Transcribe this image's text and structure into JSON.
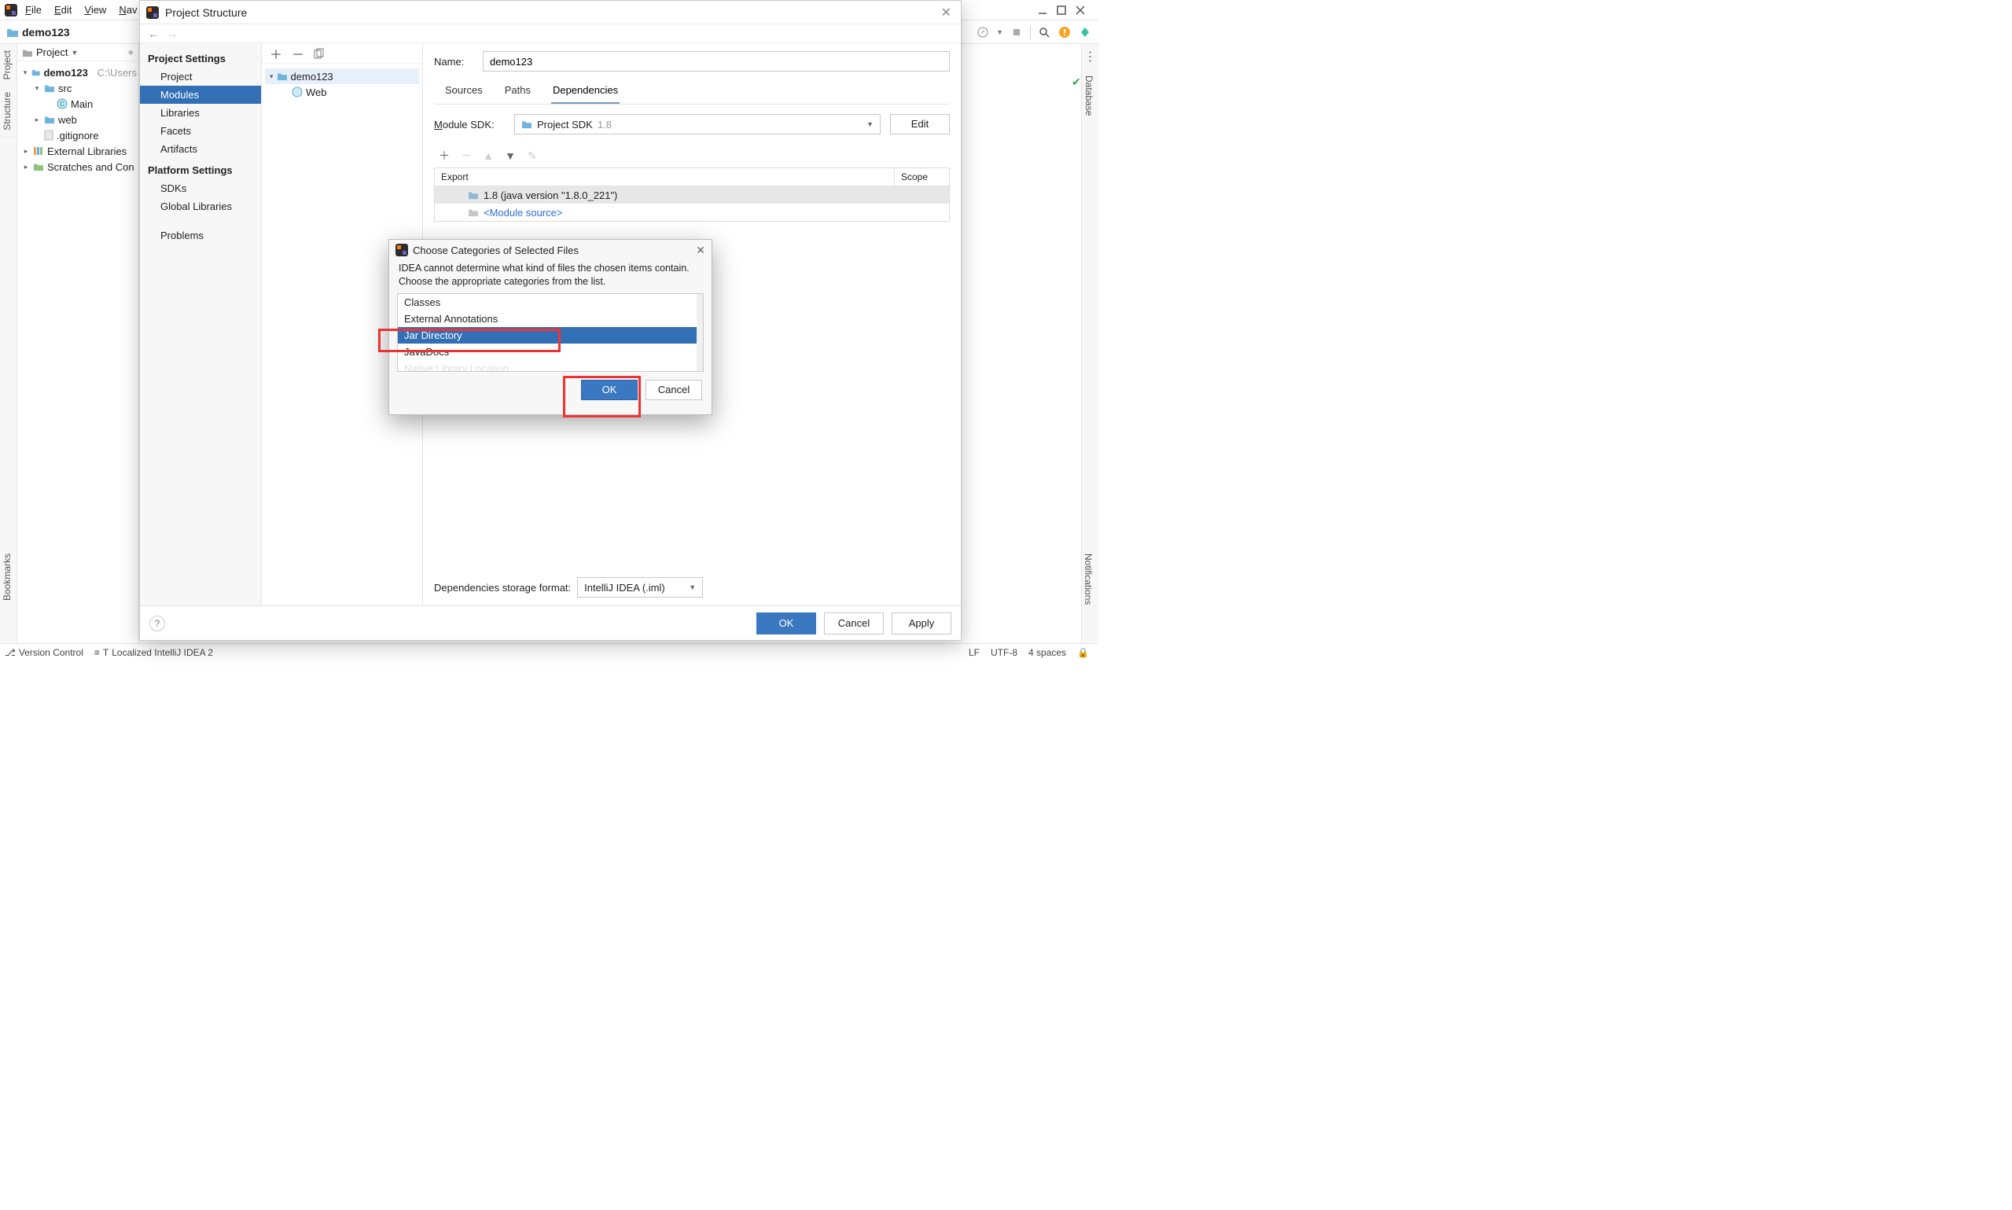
{
  "main_menu": [
    "File",
    "Edit",
    "View",
    "Nav"
  ],
  "breadcrumb": {
    "project": "demo123"
  },
  "left_rail_tabs": [
    "Project",
    "Structure"
  ],
  "right_rail_tabs": [
    "Database"
  ],
  "bottom_left_rail": "Bookmarks",
  "bottom_right_rail": "Notifications",
  "project_tool": {
    "title": "Project",
    "nodes": [
      {
        "label": "demo123",
        "suffix": "C:\\Users",
        "bold": true,
        "indent": 0,
        "arrow": "down",
        "icon": "folder"
      },
      {
        "label": "src",
        "indent": 1,
        "arrow": "down",
        "icon": "folder-blue"
      },
      {
        "label": "Main",
        "indent": 2,
        "icon": "class"
      },
      {
        "label": "web",
        "indent": 1,
        "arrow": "right",
        "icon": "folder-blue"
      },
      {
        "label": ".gitignore",
        "indent": 1,
        "icon": "file"
      },
      {
        "label": "External Libraries",
        "indent": 0,
        "arrow": "right",
        "icon": "lib"
      },
      {
        "label": "Scratches and Con",
        "indent": 0,
        "arrow": "right",
        "icon": "scratch"
      }
    ]
  },
  "bottom_tabs": [
    "Version Control",
    "T"
  ],
  "status_bar": {
    "msg": "Localized IntelliJ IDEA 2",
    "right": [
      "LF",
      "UTF-8",
      "4 spaces"
    ]
  },
  "project_structure": {
    "title": "Project Structure",
    "sections": {
      "project_settings": {
        "label": "Project Settings",
        "items": [
          "Project",
          "Modules",
          "Libraries",
          "Facets",
          "Artifacts"
        ],
        "selected": "Modules"
      },
      "platform_settings": {
        "label": "Platform Settings",
        "items": [
          "SDKs",
          "Global Libraries"
        ]
      },
      "problems": {
        "label": "",
        "items": [
          "Problems"
        ]
      }
    },
    "module_tree": [
      {
        "label": "demo123",
        "expanded": true,
        "selected": true,
        "icon": "folder"
      },
      {
        "label": "Web",
        "icon": "web",
        "indent": 1
      }
    ],
    "name_label": "Name:",
    "name_value": "demo123",
    "tabs": [
      "Sources",
      "Paths",
      "Dependencies"
    ],
    "tab_selected": "Dependencies",
    "sdk_label": "Module SDK:",
    "sdk_value": "Project SDK",
    "sdk_version": "1.8",
    "edit_button": "Edit",
    "deps_headers": {
      "export": "Export",
      "scope": "Scope"
    },
    "deps_rows": [
      {
        "text": "1.8 (java version \"1.8.0_221\")",
        "icon": "folder",
        "selected": true
      },
      {
        "text": "<Module source>",
        "icon": "folder",
        "link": true
      }
    ],
    "storage_label": "Dependencies storage format:",
    "storage_value": "IntelliJ IDEA (.iml)",
    "footer": {
      "ok": "OK",
      "cancel": "Cancel",
      "apply": "Apply"
    }
  },
  "choose_categories": {
    "title": "Choose Categories of Selected Files",
    "msg": "IDEA cannot determine what kind of files the chosen items contain. Choose the appropriate categories from the list.",
    "items": [
      "Classes",
      "External Annotations",
      "Jar Directory",
      "JavaDocs",
      "Native Library Location"
    ],
    "selected": "Jar Directory",
    "ok": "OK",
    "cancel": "Cancel"
  }
}
